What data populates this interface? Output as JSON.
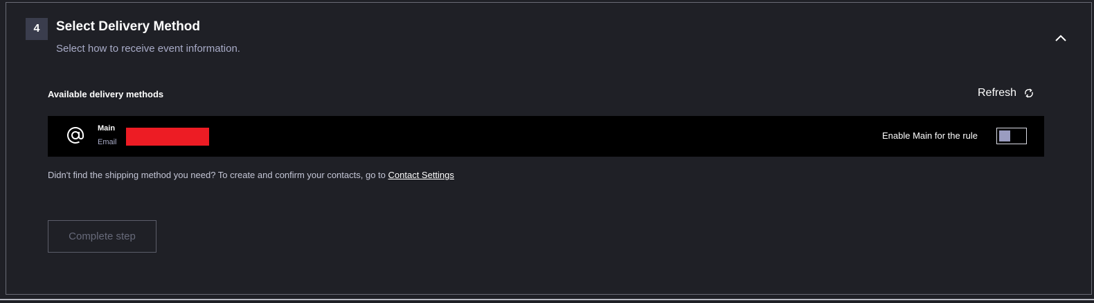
{
  "step": {
    "number": "4",
    "title": "Select Delivery Method",
    "subtitle": "Select how to receive event information."
  },
  "delivery": {
    "section_label": "Available delivery methods",
    "refresh_label": "Refresh",
    "methods": [
      {
        "name": "Main",
        "type": "Email",
        "enable_label": "Enable Main for the rule",
        "enabled": false
      }
    ]
  },
  "help": {
    "text": "Didn't find the shipping method you need? To create and confirm your contacts, go to ",
    "link_label": "Contact Settings"
  },
  "actions": {
    "complete_label": "Complete step"
  },
  "colors": {
    "background": "#1f2026",
    "row_background": "#000000",
    "badge": "#3a3d4d",
    "redaction": "#ed1c24",
    "toggle_knob": "#9a9cc0"
  },
  "icons": {
    "collapse": "chevron-up-icon",
    "refresh": "refresh-icon",
    "method": "at-sign-icon"
  }
}
